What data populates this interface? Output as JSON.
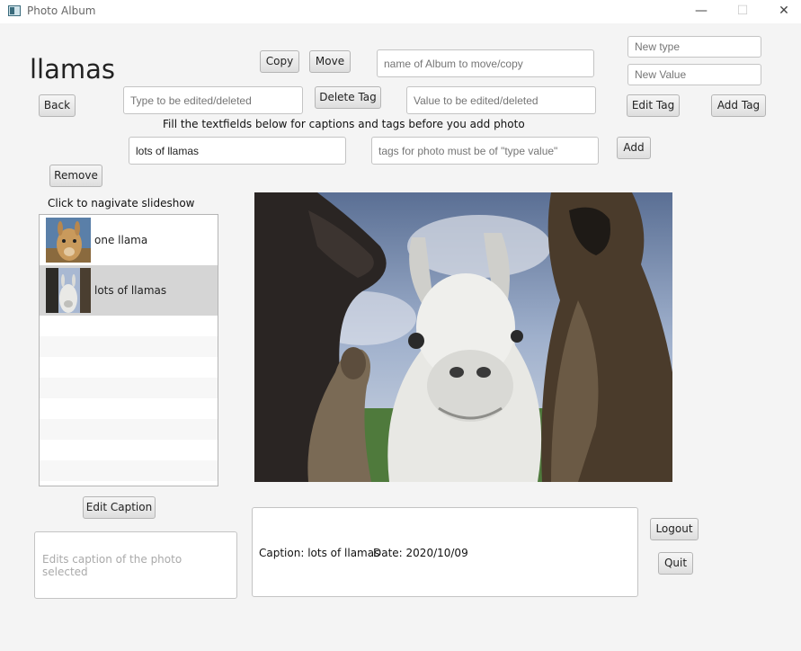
{
  "window": {
    "title": "Photo Album",
    "minimize": "—",
    "maximize": "☐",
    "close": "✕"
  },
  "album": {
    "name": "llamas"
  },
  "buttons": {
    "copy": "Copy",
    "move": "Move",
    "back": "Back",
    "delete_tag": "Delete Tag",
    "edit_tag": "Edit Tag",
    "add_tag": "Add Tag",
    "add": "Add",
    "remove": "Remove",
    "edit_caption": "Edit Caption",
    "logout": "Logout",
    "quit": "Quit"
  },
  "fields": {
    "album_target": {
      "placeholder": "name of Album to move/copy",
      "value": ""
    },
    "new_type": {
      "placeholder": "New type",
      "value": ""
    },
    "new_value": {
      "placeholder": "New Value",
      "value": ""
    },
    "tag_type_edit": {
      "placeholder": "Type to be edited/deleted",
      "value": ""
    },
    "tag_value_edit": {
      "placeholder": "Value to be edited/deleted",
      "value": ""
    },
    "new_caption": {
      "placeholder": "",
      "value": "lots of llamas"
    },
    "new_tags": {
      "placeholder": "tags for photo must be of \"type value\"",
      "value": ""
    },
    "caption_edit": {
      "placeholder": "Edits caption of the photo selected",
      "value": ""
    }
  },
  "labels": {
    "instructions": "Fill the textfields below for captions and tags before you add photo",
    "slideshow_hint": "Click to nagivate slideshow"
  },
  "photos": [
    {
      "caption": "one llama",
      "selected": false
    },
    {
      "caption": "lots of llamas",
      "selected": true
    }
  ],
  "details": {
    "caption_text": "Caption: lots of llamas",
    "date_text": "Date: 2020/10/09"
  }
}
